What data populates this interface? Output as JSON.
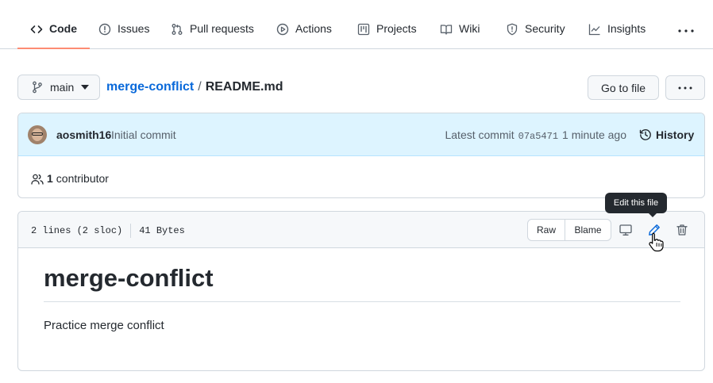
{
  "nav": {
    "tabs": [
      {
        "label": "Code",
        "icon": "code-icon",
        "active": true
      },
      {
        "label": "Issues",
        "icon": "issue-icon"
      },
      {
        "label": "Pull requests",
        "icon": "pull-request-icon"
      },
      {
        "label": "Actions",
        "icon": "play-icon"
      },
      {
        "label": "Projects",
        "icon": "project-icon"
      },
      {
        "label": "Wiki",
        "icon": "book-icon"
      },
      {
        "label": "Security",
        "icon": "shield-icon"
      },
      {
        "label": "Insights",
        "icon": "graph-icon"
      }
    ],
    "more_icon": "kebab-horizontal-icon"
  },
  "breadcrumb": {
    "branch": "main",
    "repo": "merge-conflict",
    "separator": "/",
    "file": "README.md",
    "goto_file": "Go to file"
  },
  "commit": {
    "author": "aosmith16",
    "message": "Initial commit",
    "latest_label": "Latest commit",
    "sha": "07a5471",
    "time": "1 minute ago",
    "history_label": "History"
  },
  "contributors": {
    "count": "1",
    "label": "contributor"
  },
  "file": {
    "lines": "2 lines (2 sloc)",
    "size": "41 Bytes",
    "raw_label": "Raw",
    "blame_label": "Blame",
    "tooltip": "Edit this file"
  },
  "readme": {
    "heading": "merge-conflict",
    "body": "Practice merge conflict"
  },
  "colors": {
    "accent_link": "#0969da",
    "active_tab_underline": "#fd8c73",
    "commit_bar_bg": "#ddf4ff",
    "edit_icon": "#0969da"
  }
}
